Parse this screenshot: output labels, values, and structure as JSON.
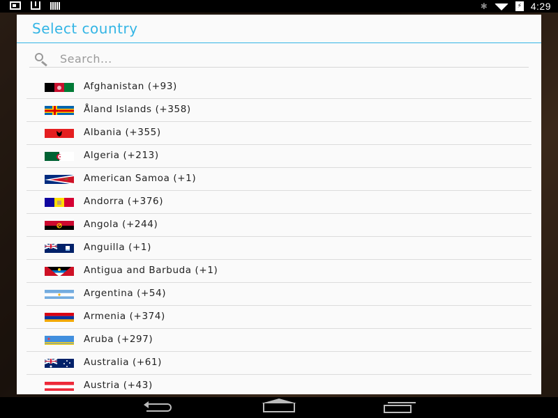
{
  "status_bar": {
    "time": "4:29",
    "battery_glyph": "⚡"
  },
  "dialog": {
    "title": "Select country",
    "search": {
      "placeholder": "Search...",
      "value": ""
    },
    "countries": [
      {
        "label": "Afghanistan (+93)",
        "flag": "af"
      },
      {
        "label": "Åland Islands (+358)",
        "flag": "ax"
      },
      {
        "label": "Albania (+355)",
        "flag": "al"
      },
      {
        "label": "Algeria (+213)",
        "flag": "dz"
      },
      {
        "label": "American Samoa (+1)",
        "flag": "as"
      },
      {
        "label": "Andorra (+376)",
        "flag": "ad"
      },
      {
        "label": "Angola (+244)",
        "flag": "ao"
      },
      {
        "label": "Anguilla (+1)",
        "flag": "ai"
      },
      {
        "label": "Antigua and Barbuda (+1)",
        "flag": "ag"
      },
      {
        "label": "Argentina (+54)",
        "flag": "ar"
      },
      {
        "label": "Armenia (+374)",
        "flag": "am"
      },
      {
        "label": "Aruba (+297)",
        "flag": "aw"
      },
      {
        "label": "Australia (+61)",
        "flag": "au"
      },
      {
        "label": "Austria (+43)",
        "flag": "at"
      }
    ]
  },
  "colors": {
    "accent": "#33b5e5"
  }
}
